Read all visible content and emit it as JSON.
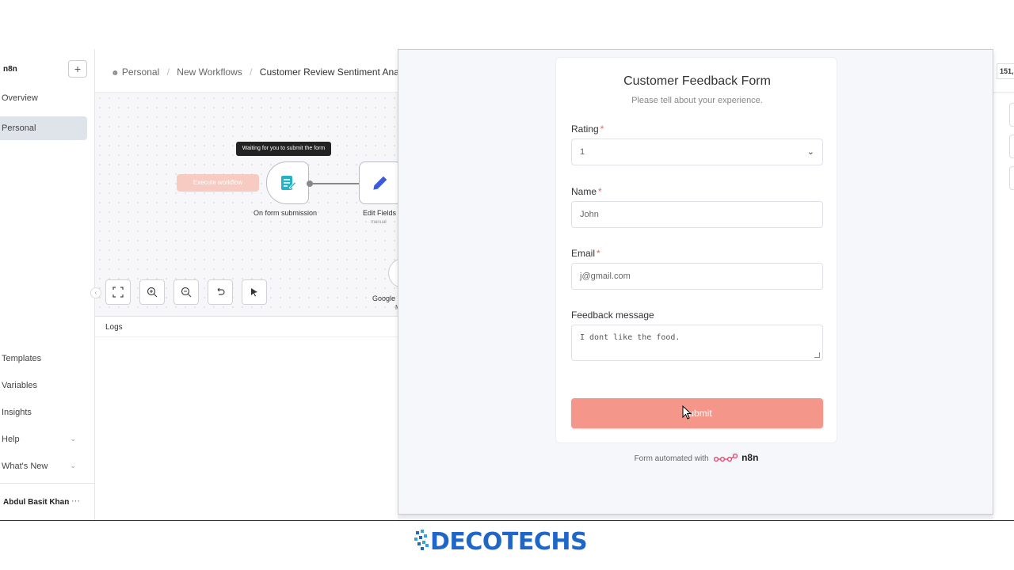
{
  "sidebar": {
    "brand": "n8n",
    "add_label": "+",
    "nav": [
      {
        "label": "Overview"
      },
      {
        "label": "Personal"
      }
    ],
    "bottom_nav": [
      {
        "label": "Templates"
      },
      {
        "label": "Variables"
      },
      {
        "label": "Insights"
      },
      {
        "label": "Help"
      },
      {
        "label": "What's New"
      }
    ],
    "user_name": "Abdul Basit Khan",
    "user_more": "···"
  },
  "header": {
    "crumbs": [
      "Personal",
      "New Workflows",
      "Customer Review Sentiment Analy"
    ],
    "count": "151,"
  },
  "canvas": {
    "tooltip": "Waiting for you to submit the form",
    "execute_label": "Execute workflow",
    "trigger_label": "On form submission",
    "edit_label": "Edit Fields",
    "edit_sub": "manual",
    "google_label": "Google",
    "google_sub": "M"
  },
  "logs": {
    "title": "Logs"
  },
  "form": {
    "title": "Customer Feedback Form",
    "subtitle": "Please tell about your experience.",
    "rating_label": "Rating",
    "rating_value": "1",
    "name_label": "Name",
    "name_value": "John",
    "email_label": "Email",
    "email_value": "j@gmail.com",
    "feedback_label": "Feedback message",
    "feedback_value": "I dont like the food.",
    "required_mark": "*",
    "submit_label": "Submit",
    "footer_prefix": "Form automated with",
    "footer_brand": "n8n",
    "accent_color": "#f5968a"
  },
  "watermark": {
    "text": "DECOTECHS",
    "color": "#1e66c8"
  }
}
